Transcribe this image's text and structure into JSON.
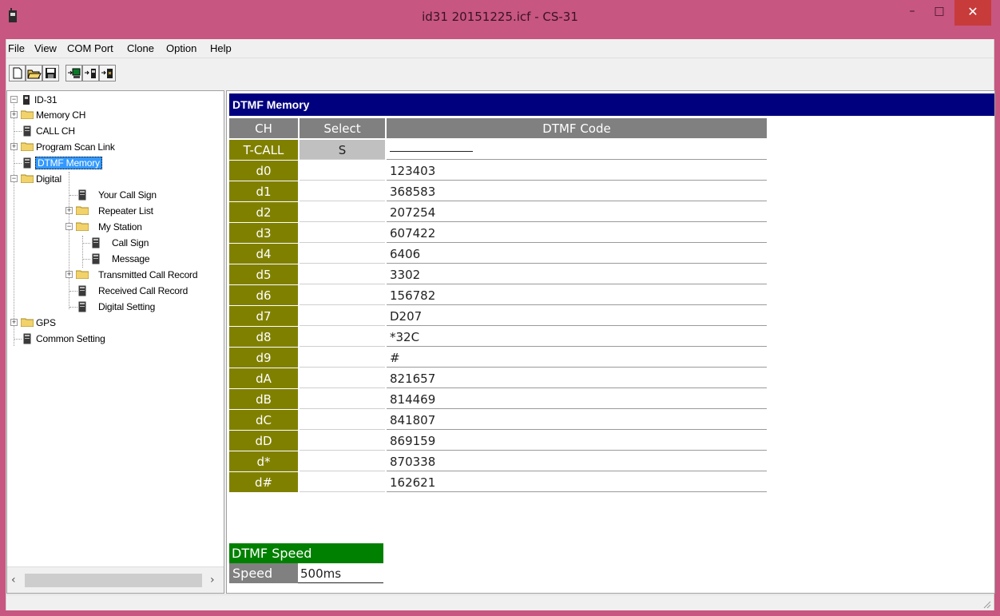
{
  "window": {
    "title": "id31 20151225.icf - CS-31",
    "minimize": "–",
    "maximize": "□",
    "close": "✕"
  },
  "menu": [
    {
      "label": "File"
    },
    {
      "label": "View"
    },
    {
      "label": "COM Port"
    },
    {
      "label": "Clone"
    },
    {
      "label": "Option"
    },
    {
      "label": "Help"
    }
  ],
  "toolbar": [
    "new-file-icon",
    "open-folder-icon",
    "save-icon",
    "read-from-radio-icon",
    "write-to-radio-icon",
    "clone-radio-icon"
  ],
  "tree": {
    "root": "ID-31",
    "items": [
      {
        "label": "Memory CH"
      },
      {
        "label": "CALL CH"
      },
      {
        "label": "Program Scan Link"
      },
      {
        "label": "DTMF Memory"
      },
      {
        "label": "Digital"
      },
      {
        "label": "Your Call Sign"
      },
      {
        "label": "Repeater List"
      },
      {
        "label": "My Station"
      },
      {
        "label": "Call Sign"
      },
      {
        "label": "Message"
      },
      {
        "label": "Transmitted Call Record"
      },
      {
        "label": "Received Call Record"
      },
      {
        "label": "Digital Setting"
      },
      {
        "label": "GPS"
      },
      {
        "label": "Common Setting"
      }
    ]
  },
  "dtmf": {
    "section_title": "DTMF Memory",
    "headers": {
      "ch": "CH",
      "select": "Select",
      "code": "DTMF Code"
    },
    "rows": [
      {
        "ch": "T-CALL",
        "select": "S",
        "code": ""
      },
      {
        "ch": "d0",
        "select": "",
        "code": "123403"
      },
      {
        "ch": "d1",
        "select": "",
        "code": "368583"
      },
      {
        "ch": "d2",
        "select": "",
        "code": "207254"
      },
      {
        "ch": "d3",
        "select": "",
        "code": "607422"
      },
      {
        "ch": "d4",
        "select": "",
        "code": "6406"
      },
      {
        "ch": "d5",
        "select": "",
        "code": "3302"
      },
      {
        "ch": "d6",
        "select": "",
        "code": "156782"
      },
      {
        "ch": "d7",
        "select": "",
        "code": "D207"
      },
      {
        "ch": "d8",
        "select": "",
        "code": "*32C"
      },
      {
        "ch": "d9",
        "select": "",
        "code": "#"
      },
      {
        "ch": "dA",
        "select": "",
        "code": "821657"
      },
      {
        "ch": "dB",
        "select": "",
        "code": "814469"
      },
      {
        "ch": "dC",
        "select": "",
        "code": "841807"
      },
      {
        "ch": "dD",
        "select": "",
        "code": "869159"
      },
      {
        "ch": "d*",
        "select": "",
        "code": "870338"
      },
      {
        "ch": "d#",
        "select": "",
        "code": "162621"
      }
    ]
  },
  "speed": {
    "section_title": "DTMF Speed",
    "label": "Speed",
    "value": "500ms"
  },
  "colors": {
    "titlebar": "#c75680",
    "header_navy": "#00007f",
    "ch_olive": "#808000",
    "speed_green": "#008000",
    "grid_gray": "#808080",
    "selection_blue": "#3399ff"
  }
}
